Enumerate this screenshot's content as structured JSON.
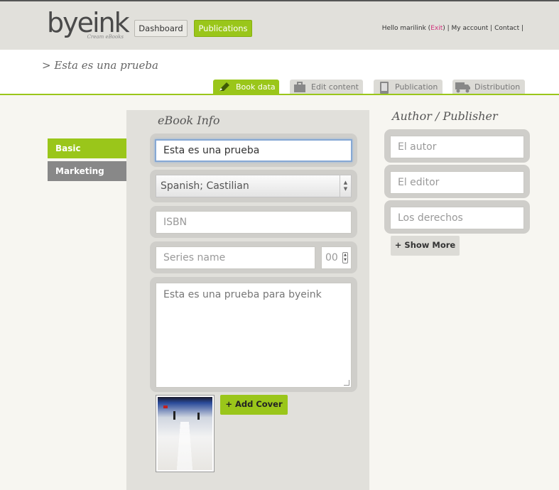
{
  "header": {
    "logo_text": "byeink",
    "logo_tagline": "Cream eBooks",
    "nav": {
      "dashboard_label": "Dashboard",
      "publications_label": "Publications"
    },
    "user": {
      "greeting": "Hello marilink",
      "exit_label": "Exit",
      "my_account_label": "My account",
      "contact_label": "Contact"
    }
  },
  "breadcrumb": "> Esta es una prueba",
  "tabs": [
    {
      "label": "Book data",
      "icon": "pencil-icon",
      "active": true
    },
    {
      "label": "Edit content",
      "icon": "briefcase-icon",
      "active": false
    },
    {
      "label": "Publication",
      "icon": "tablet-icon",
      "active": false
    },
    {
      "label": "Distribution",
      "icon": "truck-icon",
      "active": false
    }
  ],
  "side_tabs": [
    {
      "label": "Basic",
      "active": true
    },
    {
      "label": "Marketing",
      "active": false
    }
  ],
  "ebook_info": {
    "title": "eBook Info",
    "book_title_value": "Esta es una prueba",
    "language_value": "Spanish; Castilian",
    "isbn_placeholder": "ISBN",
    "series_placeholder": "Series name",
    "series_number_placeholder": "00",
    "description_value": "Esta es una prueba para byeink",
    "add_cover_label": "+ Add Cover"
  },
  "author_publisher": {
    "title": "Author / Publisher",
    "author_placeholder": "El autor",
    "editor_placeholder": "El editor",
    "rights_placeholder": "Los derechos",
    "show_more_label": "+ Show More"
  },
  "colors": {
    "accent_green": "#9ac61a",
    "header_bg": "#e1e0db",
    "exit_pink": "#d0307a"
  }
}
